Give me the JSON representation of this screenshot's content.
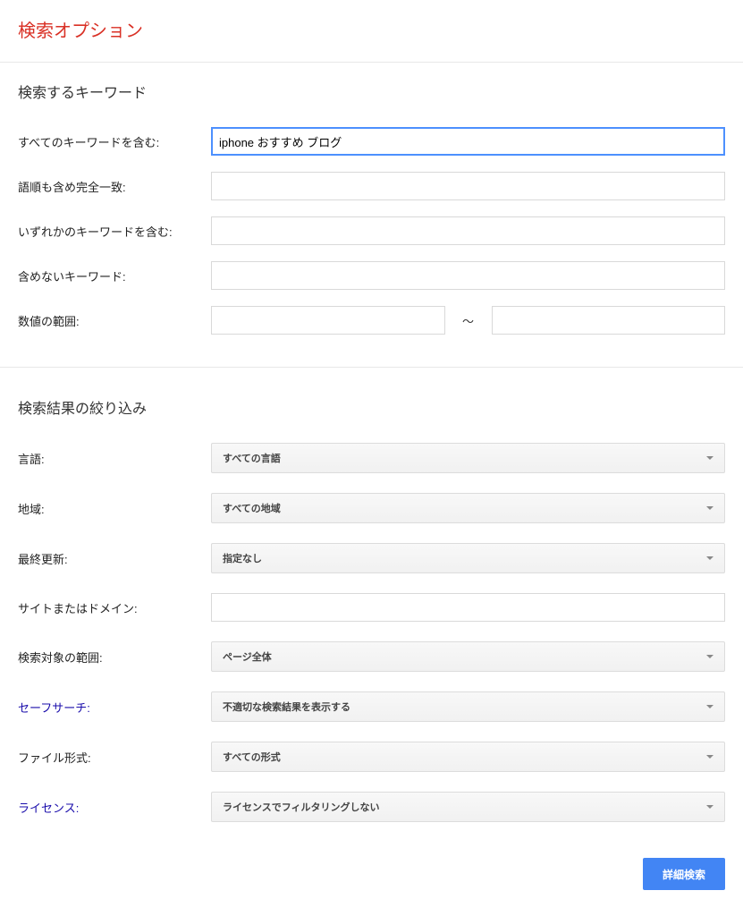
{
  "page_title": "検索オプション",
  "keywords_section": {
    "heading": "検索するキーワード",
    "all_words": {
      "label": "すべてのキーワードを含む:",
      "value": "iphone おすすめ ブログ"
    },
    "exact_phrase": {
      "label": "語順も含め完全一致:",
      "value": ""
    },
    "any_words": {
      "label": "いずれかのキーワードを含む:",
      "value": ""
    },
    "none_words": {
      "label": "含めないキーワード:",
      "value": ""
    },
    "number_range": {
      "label": "数値の範囲:",
      "from": "",
      "to": "",
      "separator": "〜"
    }
  },
  "refine_section": {
    "heading": "検索結果の絞り込み",
    "language": {
      "label": "言語:",
      "value": "すべての言語"
    },
    "region": {
      "label": "地域:",
      "value": "すべての地域"
    },
    "last_update": {
      "label": "最終更新:",
      "value": "指定なし"
    },
    "site_domain": {
      "label": "サイトまたはドメイン:",
      "value": ""
    },
    "search_scope": {
      "label": "検索対象の範囲:",
      "value": "ページ全体"
    },
    "safe_search": {
      "label": "セーフサーチ:",
      "value": "不適切な検索結果を表示する"
    },
    "file_type": {
      "label": "ファイル形式:",
      "value": "すべての形式"
    },
    "license": {
      "label": "ライセンス:",
      "value": "ライセンスでフィルタリングしない"
    }
  },
  "submit_button": "詳細検索"
}
